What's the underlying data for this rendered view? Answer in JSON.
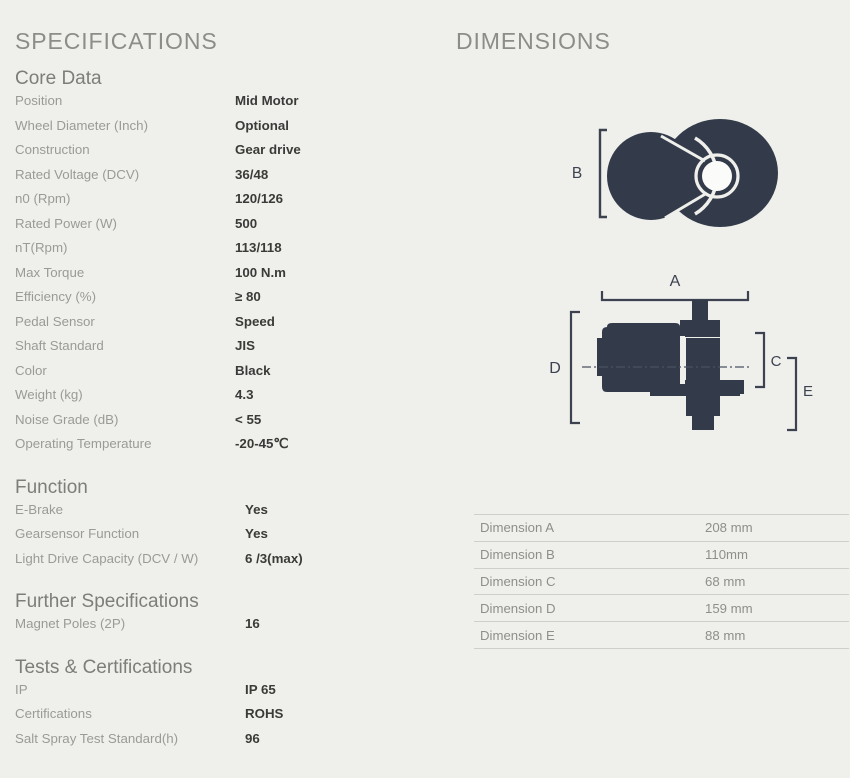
{
  "headers": {
    "specifications": "SPECIFICATIONS",
    "dimensions": "DIMENSIONS"
  },
  "spec_groups": [
    {
      "heading": "Core Data",
      "rows": [
        {
          "label": "Position",
          "value": "Mid Motor"
        },
        {
          "label": "Wheel Diameter (Inch)",
          "value": "Optional"
        },
        {
          "label": "Construction",
          "value": "Gear drive"
        },
        {
          "label": "Rated Voltage (DCV)",
          "value": "36/48"
        },
        {
          "label": "n0 (Rpm)",
          "value": "120/126"
        },
        {
          "label": "Rated Power (W)",
          "value": "500"
        },
        {
          "label": "nT(Rpm)",
          "value": "113/118"
        },
        {
          "label": "Max Torque",
          "value": "100 N.m"
        },
        {
          "label": "Efficiency (%)",
          "value": "≥ 80"
        },
        {
          "label": "Pedal Sensor",
          "value": "Speed"
        },
        {
          "label": "Shaft Standard",
          "value": "JIS"
        },
        {
          "label": "Color",
          "value": "Black"
        },
        {
          "label": "Weight (kg)",
          "value": "4.3"
        },
        {
          "label": "Noise Grade (dB)",
          "value": "< 55"
        },
        {
          "label": "Operating Temperature",
          "value": "-20-45℃"
        }
      ]
    },
    {
      "heading": "Function",
      "rows": [
        {
          "label": "E-Brake",
          "value": "Yes"
        },
        {
          "label": "Gearsensor Function",
          "value": "Yes"
        },
        {
          "label": "Light Drive Capacity (DCV / W)",
          "value": "6 /3(max)"
        }
      ]
    },
    {
      "heading": "Further Specifications",
      "rows": [
        {
          "label": "Magnet Poles (2P)",
          "value": "16"
        }
      ]
    },
    {
      "heading": "Tests & Certifications",
      "rows": [
        {
          "label": "IP",
          "value": "IP 65"
        },
        {
          "label": "Certifications",
          "value": "ROHS"
        },
        {
          "label": "Salt Spray Test Standard(h)",
          "value": "96"
        }
      ]
    }
  ],
  "dimension_labels": {
    "a": "A",
    "b": "B",
    "c": "C",
    "d": "D",
    "e": "E"
  },
  "dimensions_table": {
    "rows": [
      {
        "name": "Dimension A",
        "value": "208 mm"
      },
      {
        "name": "Dimension B",
        "value": "110mm"
      },
      {
        "name": "Dimension C",
        "value": "68 mm"
      },
      {
        "name": "Dimension D",
        "value": "159 mm"
      },
      {
        "name": "Dimension E",
        "value": "88 mm"
      }
    ]
  },
  "colors": {
    "background": "#efefeb",
    "drawing_fill": "#333b4a",
    "heading_text": "#8c8c88",
    "label_text": "#9a9a96",
    "value_text": "#3a3a38",
    "rule": "#cfcfca"
  }
}
